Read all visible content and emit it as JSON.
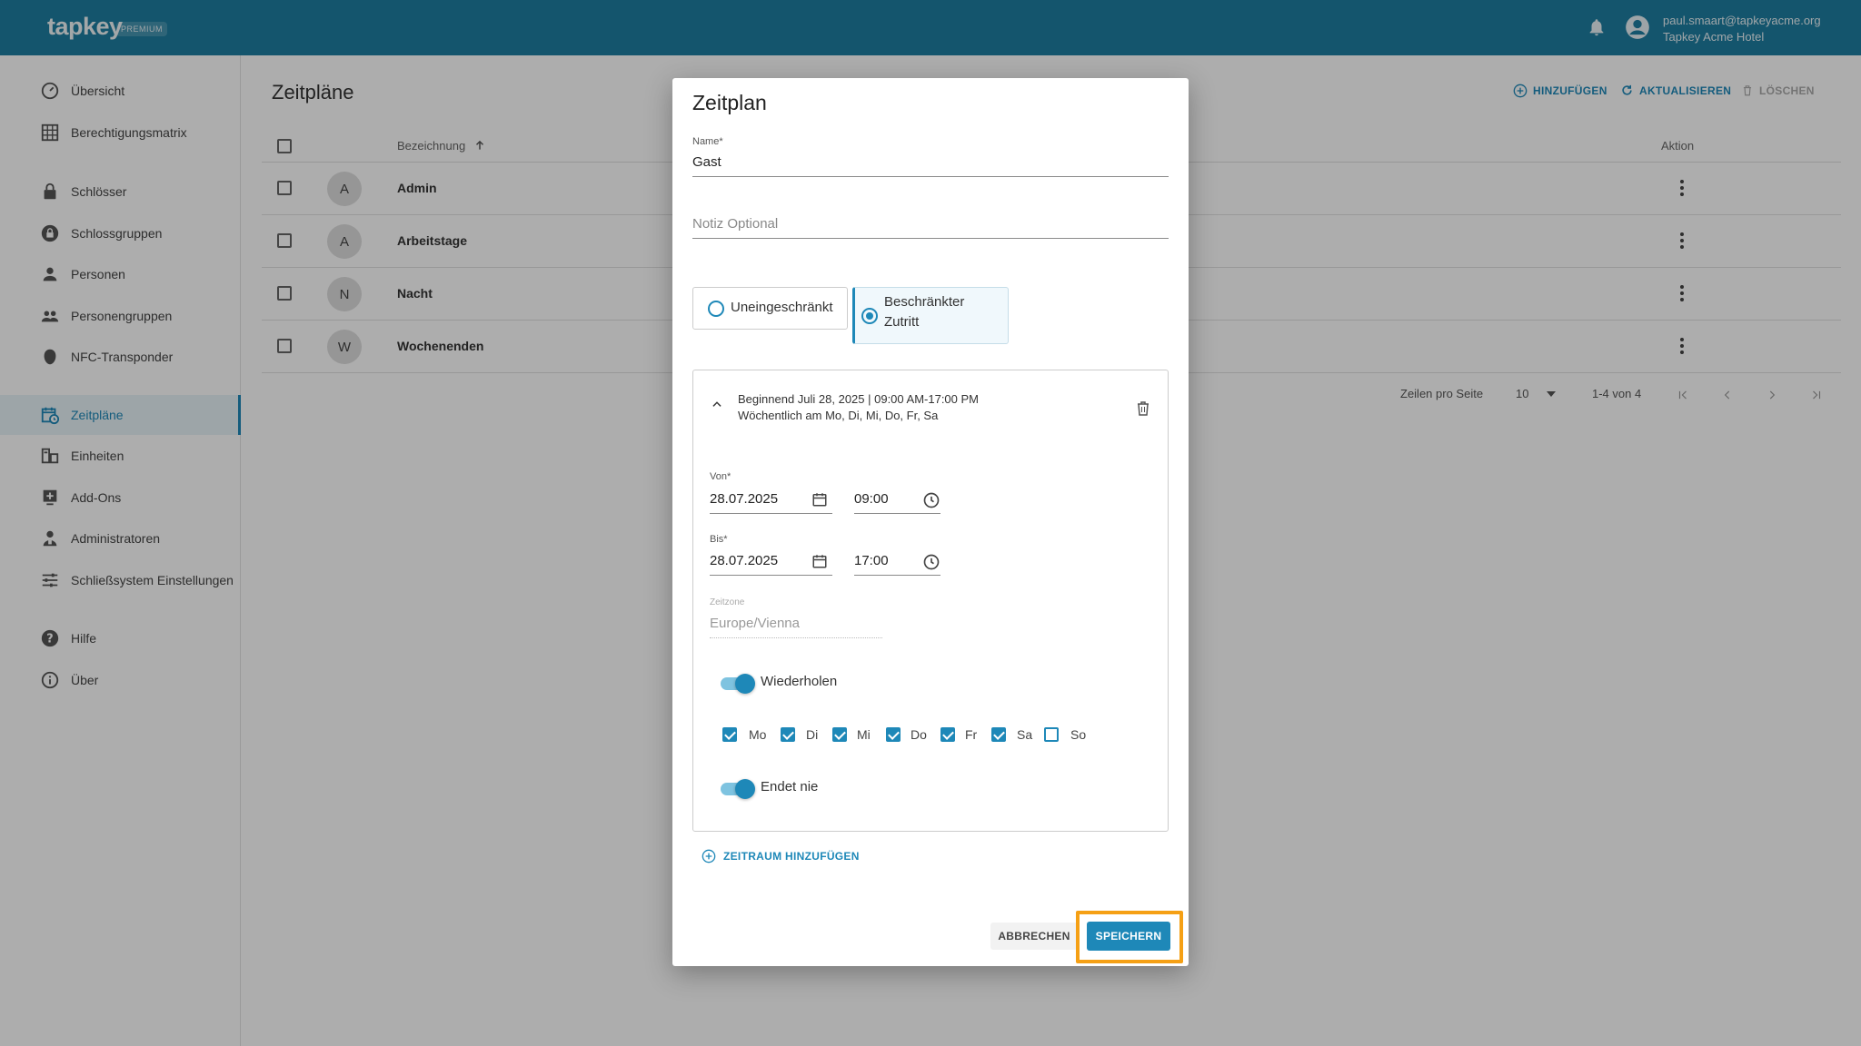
{
  "header": {
    "logo": "tapkey",
    "badge": "PREMIUM",
    "user_email": "paul.smaart@tapkeyacme.org",
    "user_org": "Tapkey Acme Hotel"
  },
  "sidebar": {
    "items": [
      {
        "label": "Übersicht",
        "icon": "dashboard-icon"
      },
      {
        "label": "Berechtigungsmatrix",
        "icon": "grid-icon"
      },
      {
        "label": "Schlösser",
        "icon": "lock-icon"
      },
      {
        "label": "Schlossgruppen",
        "icon": "lock-group-icon"
      },
      {
        "label": "Personen",
        "icon": "person-icon"
      },
      {
        "label": "Personengruppen",
        "icon": "people-icon"
      },
      {
        "label": "NFC-Transponder",
        "icon": "transponder-icon"
      },
      {
        "label": "Zeitpläne",
        "icon": "calendar-clock-icon"
      },
      {
        "label": "Einheiten",
        "icon": "units-icon"
      },
      {
        "label": "Add-Ons",
        "icon": "addon-icon"
      },
      {
        "label": "Administratoren",
        "icon": "admin-icon"
      },
      {
        "label": "Schließsystem Einstellungen",
        "icon": "settings-sliders-icon"
      },
      {
        "label": "Hilfe",
        "icon": "help-icon"
      },
      {
        "label": "Über",
        "icon": "info-icon"
      }
    ]
  },
  "main": {
    "title": "Zeitpläne",
    "toolbar": {
      "add": "HINZUFÜGEN",
      "refresh": "AKTUALISIEREN",
      "delete": "LÖSCHEN"
    },
    "table": {
      "col_name": "Bezeichnung",
      "col_action": "Aktion",
      "rows": [
        {
          "initial": "A",
          "name": "Admin"
        },
        {
          "initial": "A",
          "name": "Arbeitstage"
        },
        {
          "initial": "N",
          "name": "Nacht"
        },
        {
          "initial": "W",
          "name": "Wochenenden"
        }
      ]
    },
    "pagination": {
      "rows_per_page_label": "Zeilen pro Seite",
      "rows_per_page": "10",
      "range": "1-4 von 4"
    }
  },
  "dialog": {
    "title": "Zeitplan",
    "name_label": "Name*",
    "name_value": "Gast",
    "note_placeholder": "Notiz Optional",
    "access_options": {
      "unrestricted": "Uneingeschränkt",
      "restricted_line1": "Beschränkter",
      "restricted_line2": "Zutritt"
    },
    "period": {
      "summary_line1": "Beginnend Juli 28, 2025 | 09:00 AM-17:00 PM",
      "summary_line2": "Wöchentlich am Mo, Di, Mi, Do, Fr, Sa",
      "from_label": "Von*",
      "from_date": "28.07.2025",
      "from_time": "09:00",
      "to_label": "Bis*",
      "to_date": "28.07.2025",
      "to_time": "17:00",
      "timezone_label": "Zeitzone",
      "timezone_value": "Europe/Vienna",
      "repeat_label": "Wiederholen",
      "days": [
        {
          "label": "Mo",
          "checked": true
        },
        {
          "label": "Di",
          "checked": true
        },
        {
          "label": "Mi",
          "checked": true
        },
        {
          "label": "Do",
          "checked": true
        },
        {
          "label": "Fr",
          "checked": true
        },
        {
          "label": "Sa",
          "checked": true
        },
        {
          "label": "So",
          "checked": false
        }
      ],
      "ends_never_label": "Endet nie"
    },
    "add_period": "ZEITRAUM HINZUFÜGEN",
    "cancel": "ABBRECHEN",
    "save": "SPEICHERN"
  },
  "colors": {
    "primary": "#1e88b8",
    "header": "#1e7ea1",
    "highlight": "#f5a015"
  }
}
